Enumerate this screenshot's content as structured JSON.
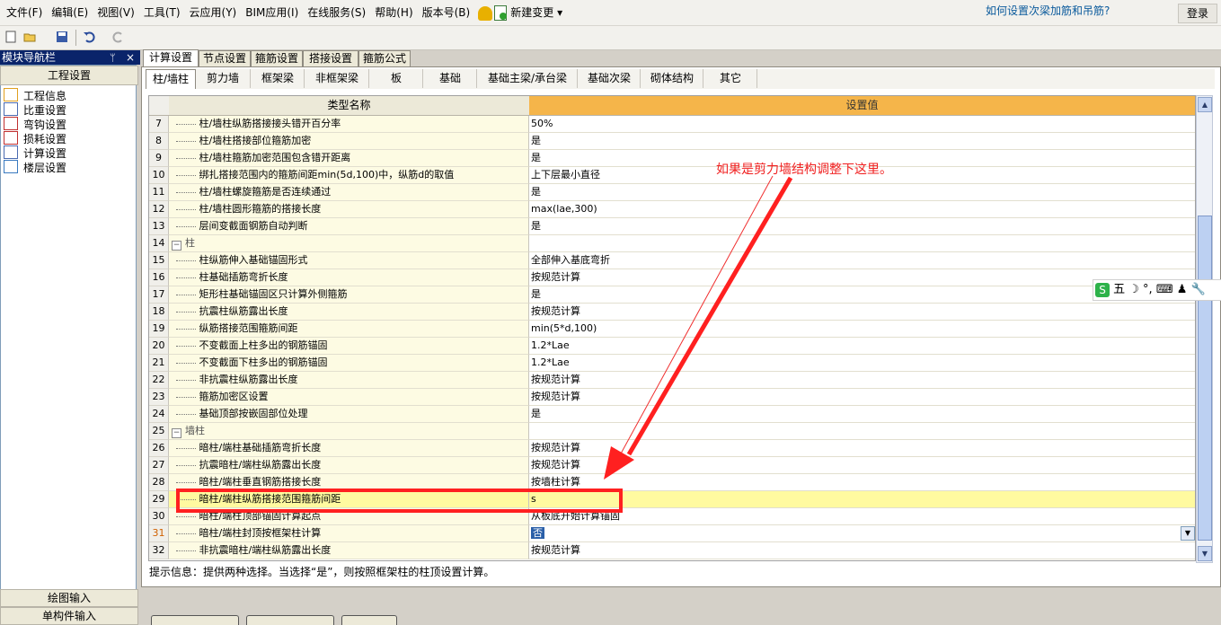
{
  "menu": {
    "items": [
      "文件(F)",
      "编辑(E)",
      "视图(V)",
      "工具(T)",
      "云应用(Y)",
      "BIM应用(I)",
      "在线服务(S)",
      "帮助(H)",
      "版本号(B)"
    ],
    "new_change": "新建变更",
    "help_link": "如何设置次梁加筋和吊筋?",
    "login": "登录"
  },
  "nav": {
    "title": "模块导航栏",
    "pin": "ᛘ",
    "close": "×",
    "header": "工程设置",
    "items": [
      {
        "label": "工程信息",
        "icon": "project-info-icon"
      },
      {
        "label": "比重设置",
        "icon": "weight-settings-icon"
      },
      {
        "label": "弯钩设置",
        "icon": "hook-settings-icon"
      },
      {
        "label": "损耗设置",
        "icon": "loss-settings-icon"
      },
      {
        "label": "计算设置",
        "icon": "calc-settings-icon"
      },
      {
        "label": "楼层设置",
        "icon": "floor-settings-icon"
      }
    ],
    "bottom1": "绘图输入",
    "bottom2": "单构件输入"
  },
  "tabs": [
    "计算设置",
    "节点设置",
    "箍筋设置",
    "搭接设置",
    "箍筋公式"
  ],
  "subtabs": [
    "柱/墙柱",
    "剪力墙",
    "框架梁",
    "非框架梁",
    "板",
    "基础",
    "基础主梁/承台梁",
    "基础次梁",
    "砌体结构",
    "其它"
  ],
  "grid": {
    "col_name": "类型名称",
    "col_value": "设置值",
    "rows": [
      {
        "n": "7",
        "name": "柱/墙柱纵筋搭接接头错开百分率",
        "value": "50%"
      },
      {
        "n": "8",
        "name": "柱/墙柱搭接部位箍筋加密",
        "value": "是"
      },
      {
        "n": "9",
        "name": "柱/墙柱箍筋加密范围包含错开距离",
        "value": "是"
      },
      {
        "n": "10",
        "name": "绑扎搭接范围内的箍筋间距min(5d,100)中，纵筋d的取值",
        "value": "上下层最小直径"
      },
      {
        "n": "11",
        "name": "柱/墙柱螺旋箍筋是否连续通过",
        "value": "是"
      },
      {
        "n": "12",
        "name": "柱/墙柱圆形箍筋的搭接长度",
        "value": "max(lae,300)"
      },
      {
        "n": "13",
        "name": "层间变截面钢筋自动判断",
        "value": "是"
      },
      {
        "n": "14",
        "name": "柱",
        "value": "",
        "group": true
      },
      {
        "n": "15",
        "name": "柱纵筋伸入基础锚固形式",
        "value": "全部伸入基底弯折"
      },
      {
        "n": "16",
        "name": "柱基础插筋弯折长度",
        "value": "按规范计算"
      },
      {
        "n": "17",
        "name": "矩形柱基础锚固区只计算外侧箍筋",
        "value": "是"
      },
      {
        "n": "18",
        "name": "抗震柱纵筋露出长度",
        "value": "按规范计算"
      },
      {
        "n": "19",
        "name": "纵筋搭接范围箍筋间距",
        "value": "min(5*d,100)"
      },
      {
        "n": "20",
        "name": "不变截面上柱多出的钢筋锚固",
        "value": "1.2*Lae"
      },
      {
        "n": "21",
        "name": "不变截面下柱多出的钢筋锚固",
        "value": "1.2*Lae"
      },
      {
        "n": "22",
        "name": "非抗震柱纵筋露出长度",
        "value": "按规范计算"
      },
      {
        "n": "23",
        "name": "箍筋加密区设置",
        "value": "按规范计算"
      },
      {
        "n": "24",
        "name": "基础顶部按嵌固部位处理",
        "value": "是"
      },
      {
        "n": "25",
        "name": "墙柱",
        "value": "",
        "group": true
      },
      {
        "n": "26",
        "name": "暗柱/端柱基础插筋弯折长度",
        "value": "按规范计算"
      },
      {
        "n": "27",
        "name": "抗震暗柱/端柱纵筋露出长度",
        "value": "按规范计算"
      },
      {
        "n": "28",
        "name": "暗柱/端柱垂直钢筋搭接长度",
        "value": "按墙柱计算"
      },
      {
        "n": "29",
        "name": "暗柱/端柱纵筋搭接范围箍筋间距",
        "value": "s",
        "selected": true
      },
      {
        "n": "30",
        "name": "暗柱/端柱顶部锚固计算起点",
        "value": "从板底开始计算锚固"
      },
      {
        "n": "31",
        "name": "暗柱/端柱封顶按框架柱计算",
        "value": "否",
        "current": true
      },
      {
        "n": "32",
        "name": "非抗震暗柱/端柱纵筋露出长度",
        "value": "按规范计算"
      }
    ]
  },
  "hint": "提示信息：提供两种选择。当选择“是”，则按照框架柱的柱顶设置计算。",
  "annotation": "如果是剪力墙结构调整下这里。",
  "ime": {
    "s": "S",
    "rest": "五 ☽ °, ⌨ ♟ 🔧"
  },
  "colors": {
    "accent_header": "#f5b54a",
    "annotation": "#f02020",
    "selection": "#fffaa0"
  }
}
